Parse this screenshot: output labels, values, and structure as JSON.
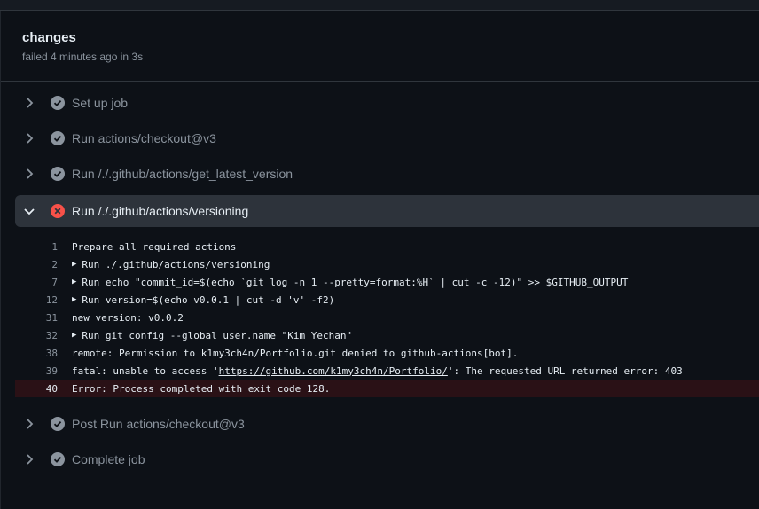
{
  "job": {
    "title": "changes",
    "status": "failed 4 minutes ago in 3s"
  },
  "steps_before": [
    {
      "label": "Set up job"
    },
    {
      "label": "Run actions/checkout@v3"
    },
    {
      "label": "Run /./.github/actions/get_latest_version"
    }
  ],
  "expanded_step": {
    "label": "Run /./.github/actions/versioning"
  },
  "log": [
    {
      "num": "1",
      "text": "Prepare all required actions"
    },
    {
      "num": "2",
      "text": "Run ./.github/actions/versioning"
    },
    {
      "num": "7",
      "text": "Run echo \"commit_id=$(echo `git log -n 1 --pretty=format:%H` | cut -c -12)\" >> $GITHUB_OUTPUT"
    },
    {
      "num": "12",
      "text": "Run version=$(echo v0.0.1 | cut -d 'v' -f2)"
    },
    {
      "num": "31",
      "text": "new version: v0.0.2"
    },
    {
      "num": "32",
      "text": "Run git config --global user.name \"Kim Yechan\""
    },
    {
      "num": "38",
      "text": "remote: Permission to k1my3ch4n/Portfolio.git denied to github-actions[bot]."
    },
    {
      "num": "39",
      "prefix": "fatal: unable to access '",
      "link": "https://github.com/k1my3ch4n/Portfolio/",
      "suffix": "': The requested URL returned error: 403"
    },
    {
      "num": "40",
      "keyword": "Error:",
      "text": " Process completed with exit code 128."
    }
  ],
  "steps_after": [
    {
      "label": "Post Run actions/checkout@v3"
    },
    {
      "label": "Complete job"
    }
  ],
  "colors": {
    "success": "#8b949e",
    "failure": "#f85149",
    "background": "#0d1117"
  }
}
